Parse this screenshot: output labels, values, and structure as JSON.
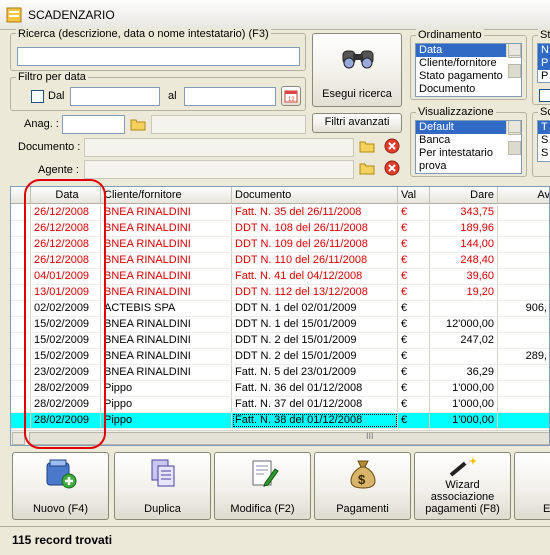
{
  "window": {
    "title": "SCADENZARIO"
  },
  "search": {
    "legend": "Ricerca (descrizione, data o nome intestatario) (F3)",
    "value": "",
    "button": "Esegui ricerca"
  },
  "date_filter": {
    "legend": "Filtro per data",
    "dal": "Dal",
    "al": "al"
  },
  "anag": {
    "label": "Anag. :"
  },
  "filtri": {
    "label": "Filtri avanzati"
  },
  "documento": {
    "label": "Documento :"
  },
  "agente": {
    "label": "Agente :"
  },
  "ordinamento": {
    "legend": "Ordinamento",
    "items": [
      "Data",
      "Cliente/fornitore",
      "Stato pagamento",
      "Documento"
    ],
    "selected": 0
  },
  "visualizzazione": {
    "legend": "Visualizzazione",
    "items": [
      "Default",
      "Banca",
      "Per intestatario",
      "prova"
    ],
    "selected": 0
  },
  "right_group": {
    "legend1": "St",
    "legend2": "Sc",
    "letters_top": [
      "N",
      "P",
      "P"
    ],
    "letters_bot": [
      "T",
      "S",
      "S"
    ]
  },
  "table": {
    "columns": [
      "",
      "Data",
      "Cliente/fornitore",
      "Documento",
      "Val",
      "Dare",
      "Av"
    ],
    "rows": [
      {
        "data": "26/12/2008",
        "cliente": "BNEA RINALDINI",
        "doc": "Fatt. N. 35 del 26/11/2008",
        "val": "€",
        "dare": "343,75",
        "avere": "",
        "style": "red"
      },
      {
        "data": "26/12/2008",
        "cliente": "BNEA RINALDINI",
        "doc": "DDT N. 108 del 26/11/2008",
        "val": "€",
        "dare": "189,96",
        "avere": "",
        "style": "red"
      },
      {
        "data": "26/12/2008",
        "cliente": "BNEA RINALDINI",
        "doc": "DDT N. 109 del 26/11/2008",
        "val": "€",
        "dare": "144,00",
        "avere": "",
        "style": "red"
      },
      {
        "data": "26/12/2008",
        "cliente": "BNEA RINALDINI",
        "doc": "DDT N. 110 del 26/11/2008",
        "val": "€",
        "dare": "248,40",
        "avere": "",
        "style": "red"
      },
      {
        "data": "04/01/2009",
        "cliente": "BNEA RINALDINI",
        "doc": "Fatt. N. 41 del 04/12/2008",
        "val": "€",
        "dare": "39,60",
        "avere": "",
        "style": "red"
      },
      {
        "data": "13/01/2009",
        "cliente": "BNEA RINALDINI",
        "doc": "DDT N. 112 del 13/12/2008",
        "val": "€",
        "dare": "19,20",
        "avere": "",
        "style": "red"
      },
      {
        "data": "02/02/2009",
        "cliente": "ACTEBIS SPA",
        "doc": "DDT N. 1 del 02/01/2009",
        "val": "€",
        "dare": "",
        "avere": "906,",
        "style": ""
      },
      {
        "data": "15/02/2009",
        "cliente": "BNEA RINALDINI",
        "doc": "DDT N. 1 del 15/01/2009",
        "val": "€",
        "dare": "12'000,00",
        "avere": "",
        "style": ""
      },
      {
        "data": "15/02/2009",
        "cliente": "BNEA RINALDINI",
        "doc": "DDT N. 2 del 15/01/2009",
        "val": "€",
        "dare": "247,02",
        "avere": "",
        "style": ""
      },
      {
        "data": "15/02/2009",
        "cliente": "BNEA RINALDINI",
        "doc": "DDT N. 2 del 15/01/2009",
        "val": "€",
        "dare": "",
        "avere": "289,",
        "style": ""
      },
      {
        "data": "23/02/2009",
        "cliente": "BNEA RINALDINI",
        "doc": "Fatt. N. 5 del 23/01/2009",
        "val": "€",
        "dare": "36,29",
        "avere": "",
        "style": ""
      },
      {
        "data": "28/02/2009",
        "cliente": "Pippo",
        "doc": "Fatt. N. 36 del 01/12/2008",
        "val": "€",
        "dare": "1'000,00",
        "avere": "",
        "style": ""
      },
      {
        "data": "28/02/2009",
        "cliente": "Pippo",
        "doc": "Fatt. N. 37 del 01/12/2008",
        "val": "€",
        "dare": "1'000,00",
        "avere": "",
        "style": ""
      },
      {
        "data": "28/02/2009",
        "cliente": "Pippo",
        "doc": "Fatt. N. 38 del 01/12/2008",
        "val": "€",
        "dare": "1'000,00",
        "avere": "",
        "style": "hl"
      }
    ],
    "scroll_grip": "III"
  },
  "toolbar": {
    "nuovo": "Nuovo (F4)",
    "duplica": "Duplica",
    "modifica": "Modifica (F2)",
    "pagamenti": "Pagamenti",
    "wizard": "Wizard associazione pagamenti (F8)",
    "last": "E"
  },
  "status": {
    "text": "115 record trovati"
  },
  "colors": {
    "red_text": "#d80000",
    "highlight": "#00ffff",
    "selection": "#316ac5"
  },
  "icons": [
    "window-icon",
    "binoculars-icon",
    "calendar-icon",
    "folder-icon",
    "delete-icon",
    "new-doc-icon",
    "duplicate-icon",
    "edit-icon",
    "money-bag-icon",
    "wizard-wand-icon"
  ]
}
